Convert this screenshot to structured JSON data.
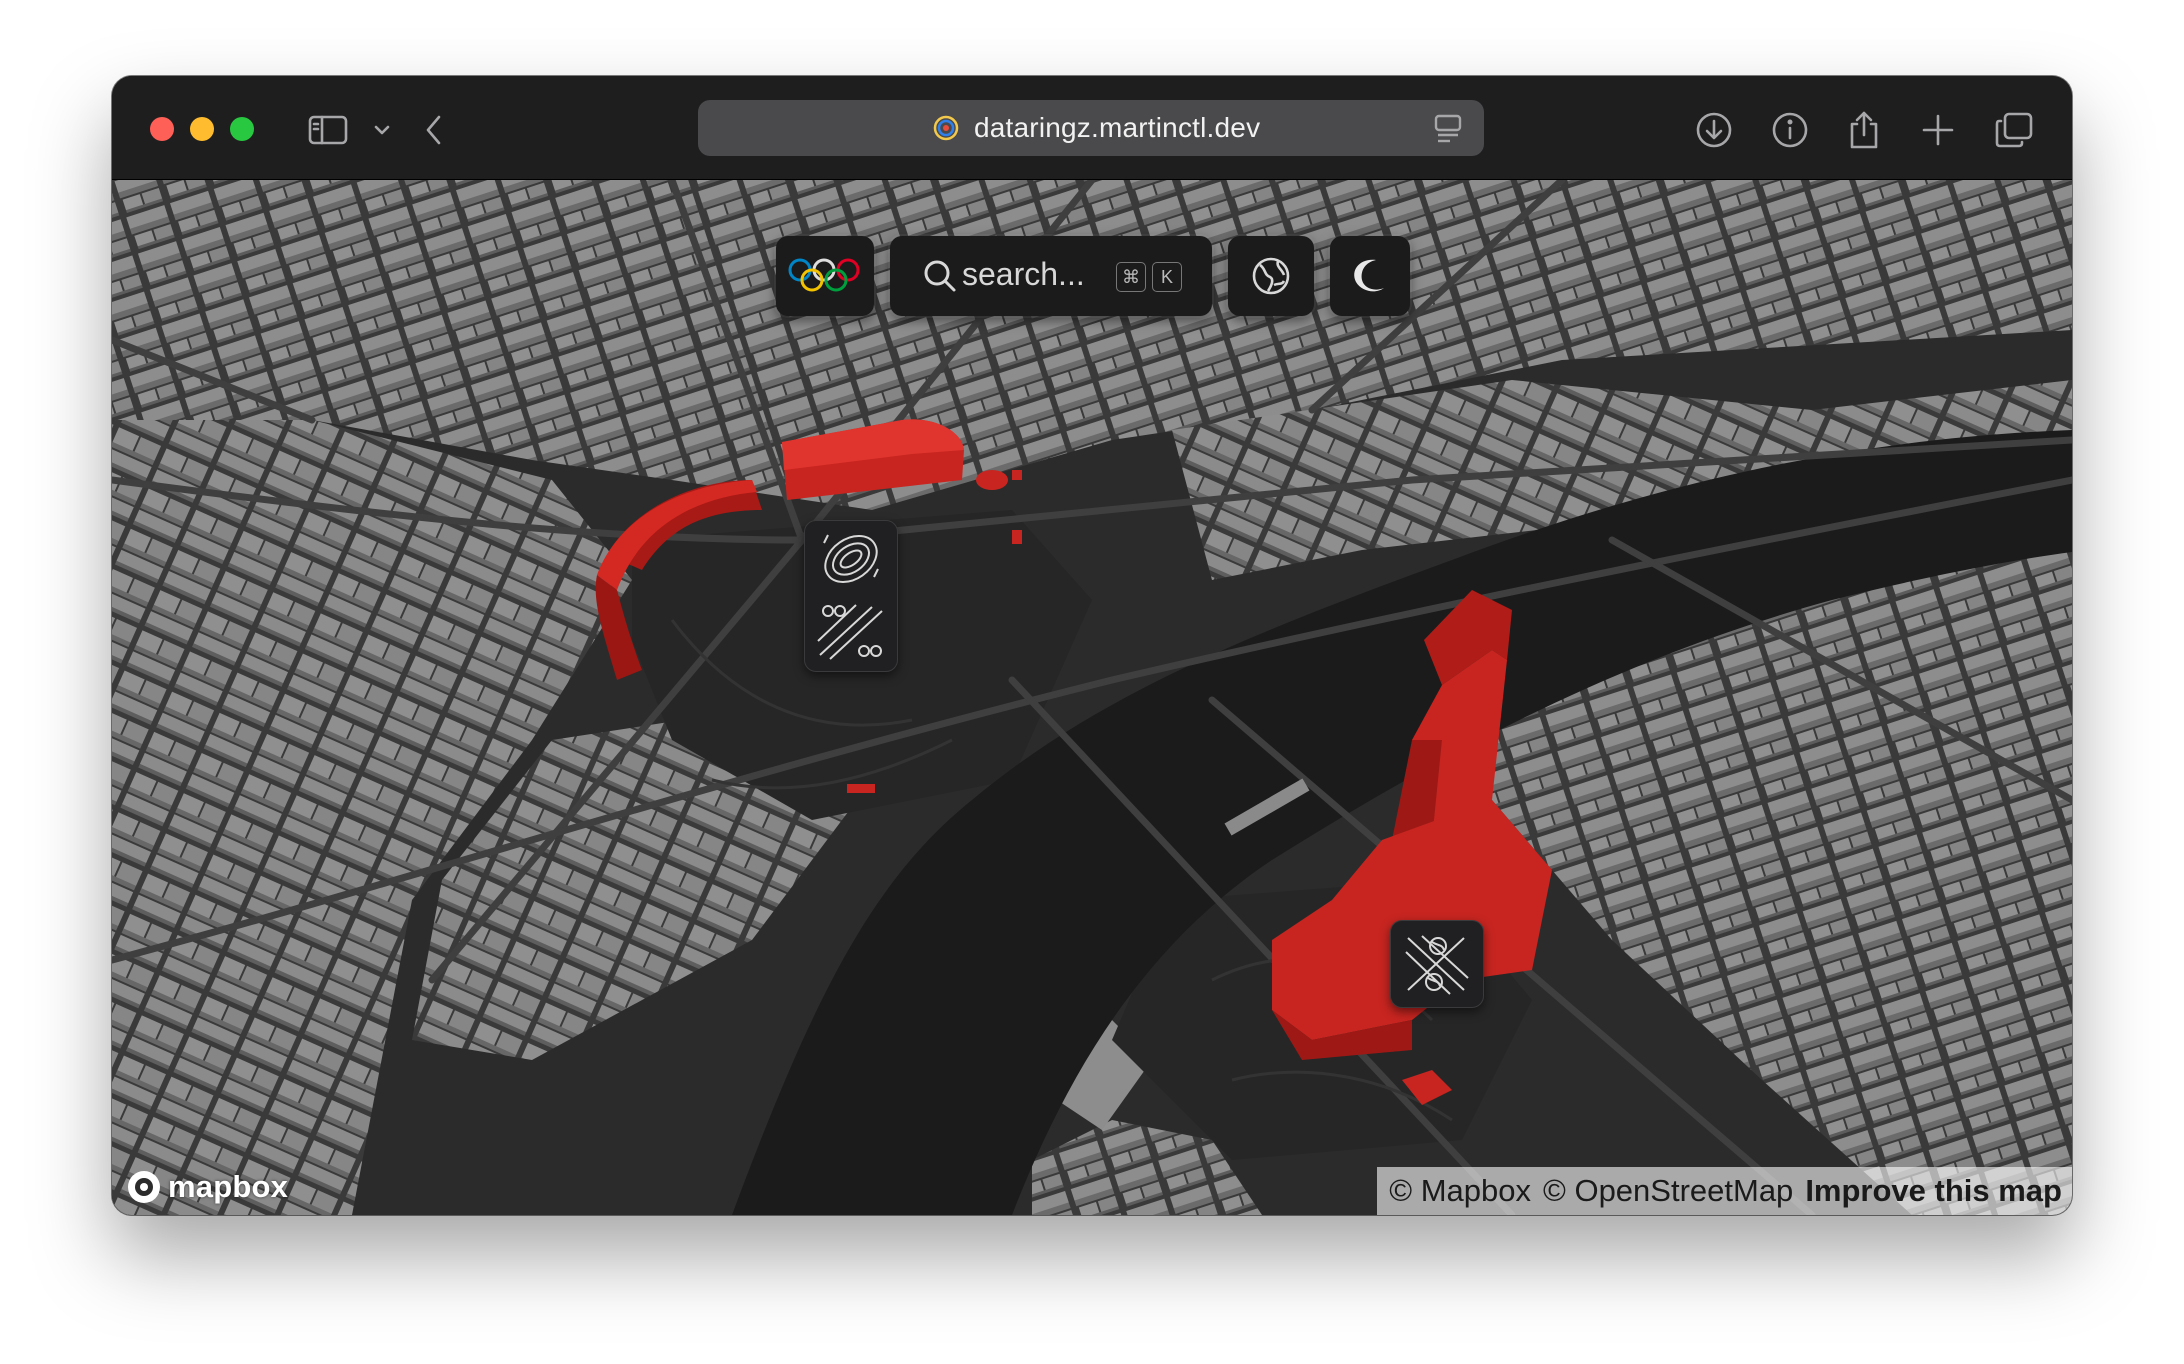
{
  "browser": {
    "url": "dataringz.martinctl.dev",
    "favicon": "dataringz-rings-icon",
    "toolbar_icons": [
      "sidebar-icon",
      "chevron-down-icon",
      "back-icon",
      "reader-icon",
      "download-icon",
      "info-icon",
      "share-icon",
      "new-tab-icon",
      "tabs-overview-icon"
    ]
  },
  "map_controls": {
    "logo_icon": "olympic-rings-icon",
    "search_placeholder": "search...",
    "shortcut_keys": [
      "⌘",
      "K"
    ],
    "globe_icon": "globe-icon",
    "theme_icon": "moon-icon"
  },
  "venue_markers": [
    {
      "sport_icons": [
        "athletics-track-icon",
        "cycling-track-icon"
      ]
    },
    {
      "sport_icons": [
        "beach-volleyball-icon"
      ]
    }
  ],
  "attribution": {
    "mapbox": "© Mapbox",
    "osm": "© OpenStreetMap",
    "improve": "Improve this map"
  },
  "brand": "mapbox",
  "colors": {
    "highlight": "#c8211c",
    "buildings": "#8a8a8a",
    "water": "#1c1c1c",
    "ground": "#2a2a2a"
  }
}
